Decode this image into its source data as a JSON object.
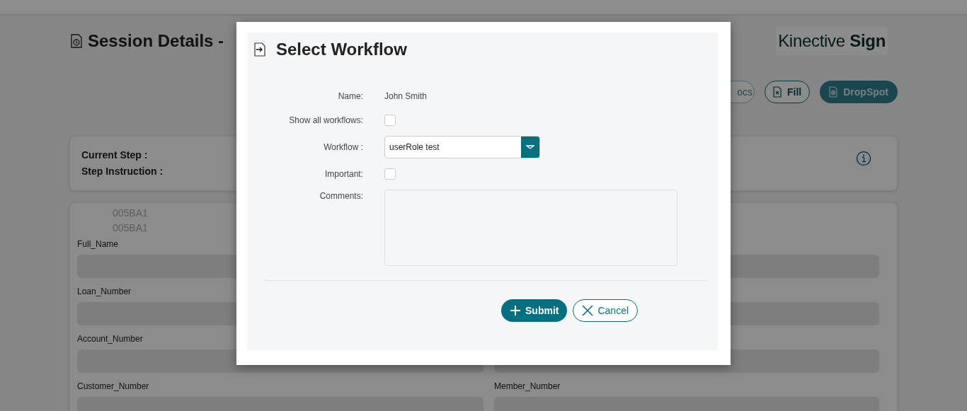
{
  "page": {
    "title": "Session Details -",
    "logo": {
      "light": "Kinective",
      "bold": "Sign"
    },
    "actions": [
      {
        "label": "ocs",
        "kind": "outline"
      },
      {
        "label": "Fill",
        "kind": "outline"
      },
      {
        "label": "DropSpot",
        "kind": "filled"
      }
    ],
    "step_card": {
      "labels": [
        "Current Step :",
        "Step Instruction :"
      ]
    },
    "form": {
      "codes": [
        "005BA1",
        "005BA1"
      ],
      "fields": [
        {
          "kind": "labeled",
          "label": "Full_Name"
        },
        {
          "kind": "bare"
        },
        {
          "kind": "labeled",
          "label": "Loan_Number"
        },
        {
          "kind": "bare"
        },
        {
          "kind": "labeled",
          "label": "Account_Number"
        },
        {
          "kind": "bare"
        },
        {
          "kind": "labeled",
          "label": "Customer_Number"
        },
        {
          "kind": "labeled",
          "label": "Member_Number"
        }
      ]
    }
  },
  "modal": {
    "title": "Select Workflow",
    "rows": [
      {
        "kind": "text",
        "label": "Name:",
        "value": "John Smith"
      },
      {
        "kind": "checkbox",
        "label": "Show all workflows:",
        "checked": false
      },
      {
        "kind": "select",
        "label": "Workflow :",
        "value": "userRole test"
      },
      {
        "kind": "checkbox",
        "label": "Important:",
        "checked": false
      },
      {
        "kind": "textarea",
        "label": "Comments:"
      }
    ],
    "buttons": [
      {
        "label": "Submit",
        "kind": "primary"
      },
      {
        "label": "Cancel",
        "kind": "secondary"
      }
    ]
  }
}
